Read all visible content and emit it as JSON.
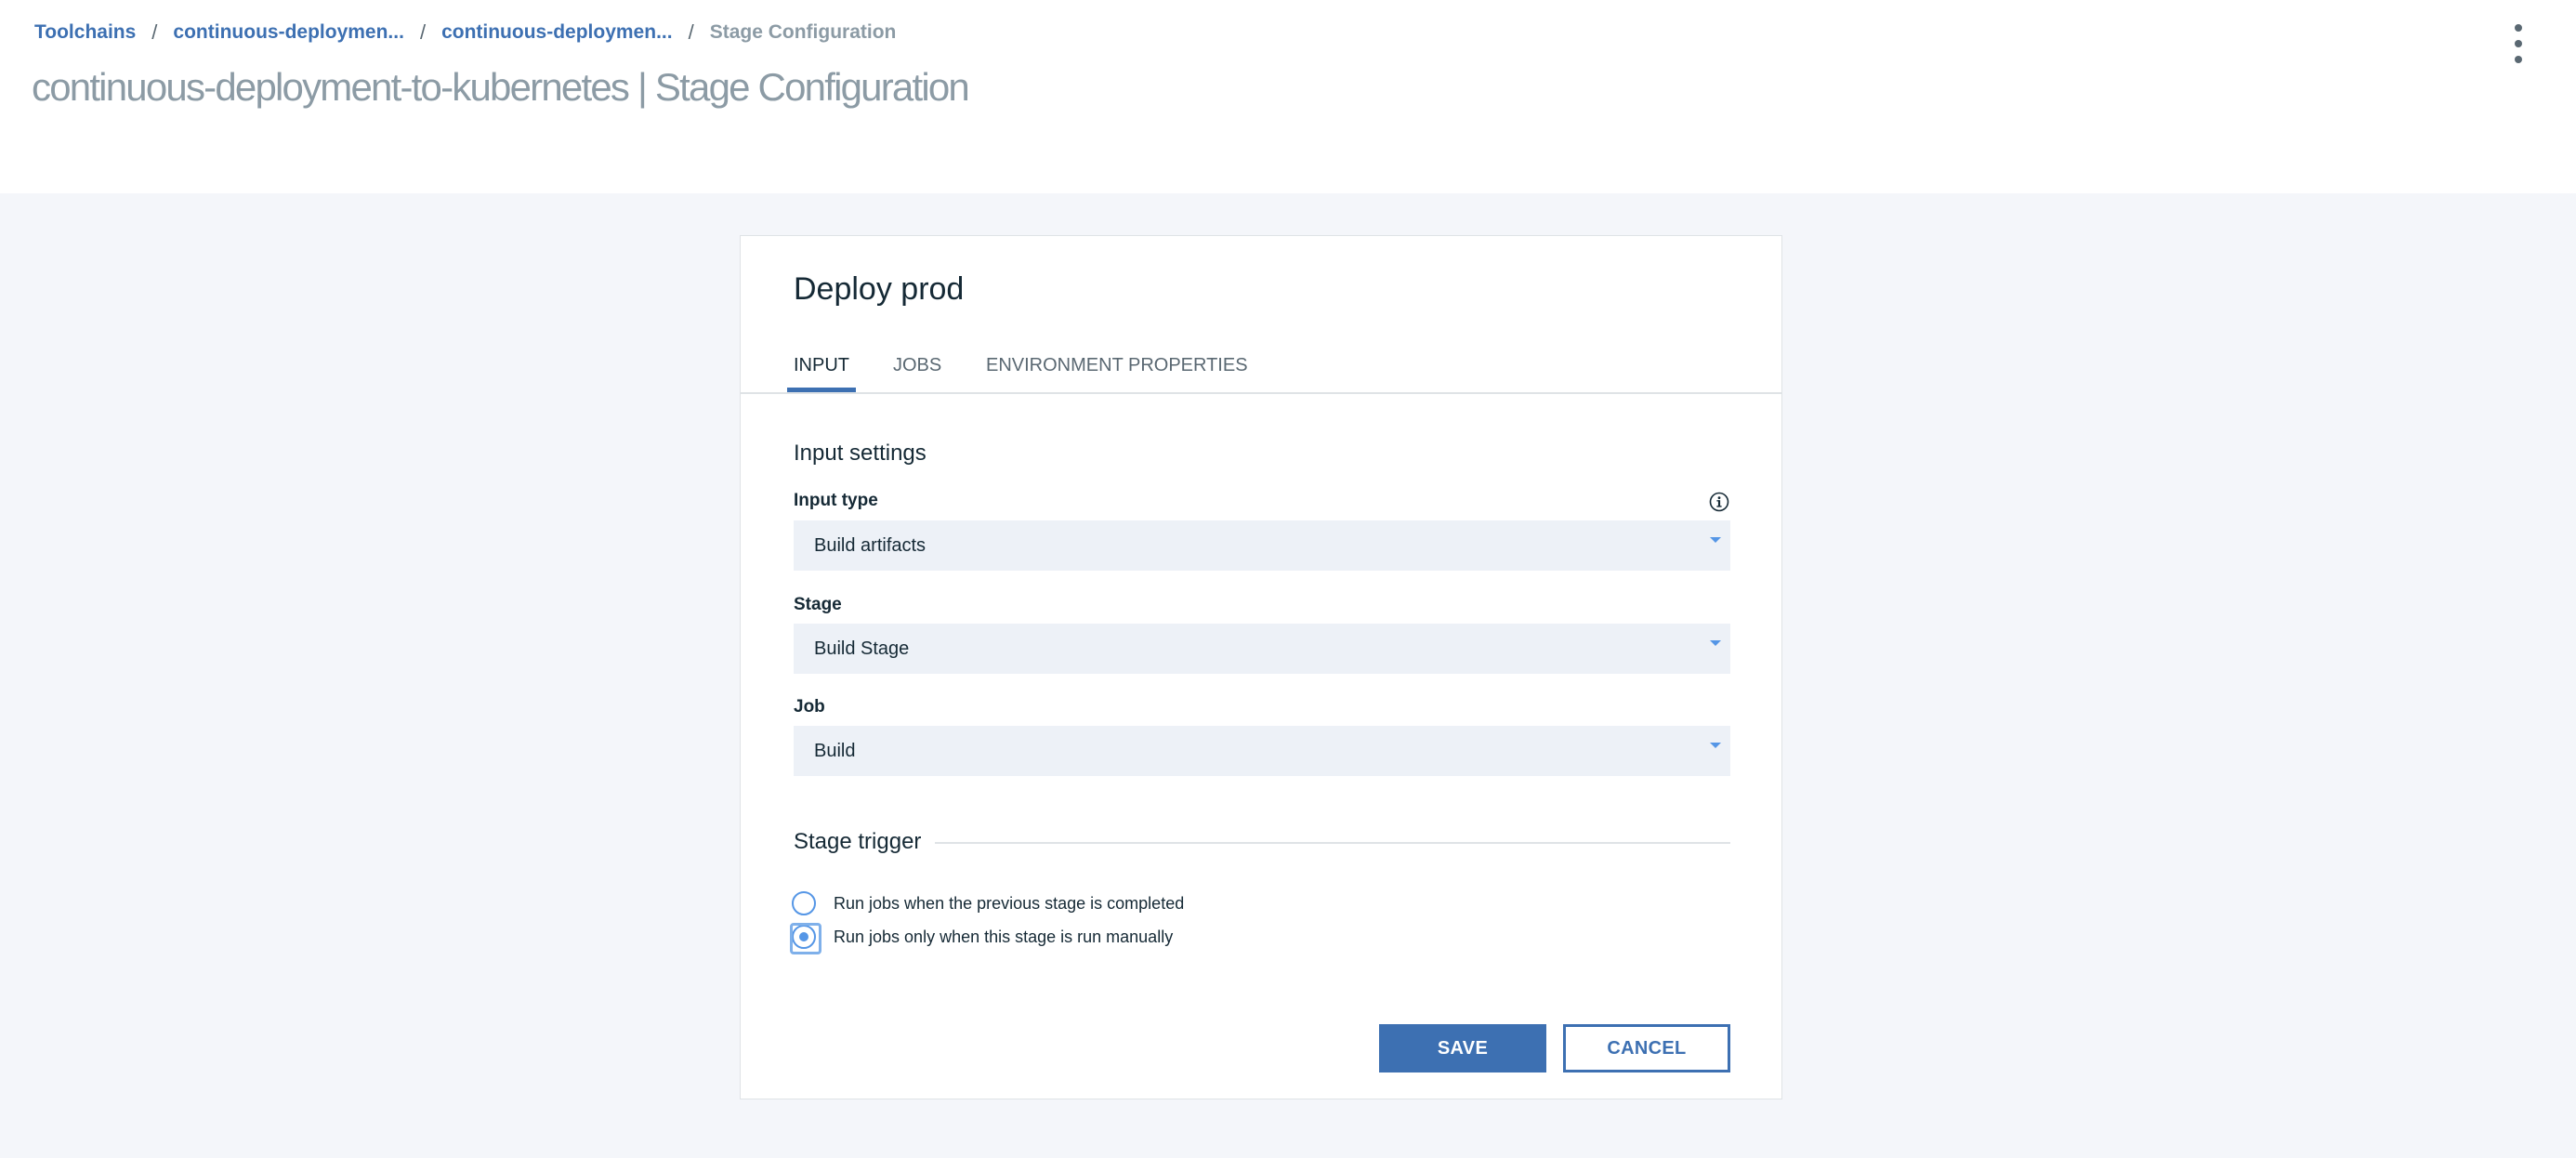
{
  "breadcrumb": {
    "items": [
      "Toolchains",
      "continuous-deploymen...",
      "continuous-deploymen..."
    ],
    "separator": "/",
    "current": "Stage Configuration"
  },
  "page": {
    "title": "continuous-deployment-to-kubernetes | Stage Configuration"
  },
  "header": {
    "overflow_menu_icon": "vertical-ellipsis-icon"
  },
  "stage": {
    "title": "Deploy prod",
    "tabs": [
      {
        "label": "INPUT",
        "active": true
      },
      {
        "label": "JOBS",
        "active": false
      },
      {
        "label": "ENVIRONMENT PROPERTIES",
        "active": false
      }
    ]
  },
  "input_settings": {
    "title": "Input settings",
    "info_icon": "info-icon",
    "input_type": {
      "label": "Input type",
      "value": "Build artifacts"
    },
    "stage": {
      "label": "Stage",
      "value": "Build Stage"
    },
    "job": {
      "label": "Job",
      "value": "Build"
    }
  },
  "stage_trigger": {
    "title": "Stage trigger",
    "options": [
      {
        "label": "Run jobs when the previous stage is completed",
        "checked": false
      },
      {
        "label": "Run jobs only when this stage is run manually",
        "checked": true
      }
    ]
  },
  "actions": {
    "save_label": "SAVE",
    "cancel_label": "CANCEL"
  },
  "colors": {
    "accent": "#3d70b2",
    "radio_accent": "#5596e6",
    "field_background": "#edf1f7",
    "page_background": "#f4f6fa"
  }
}
